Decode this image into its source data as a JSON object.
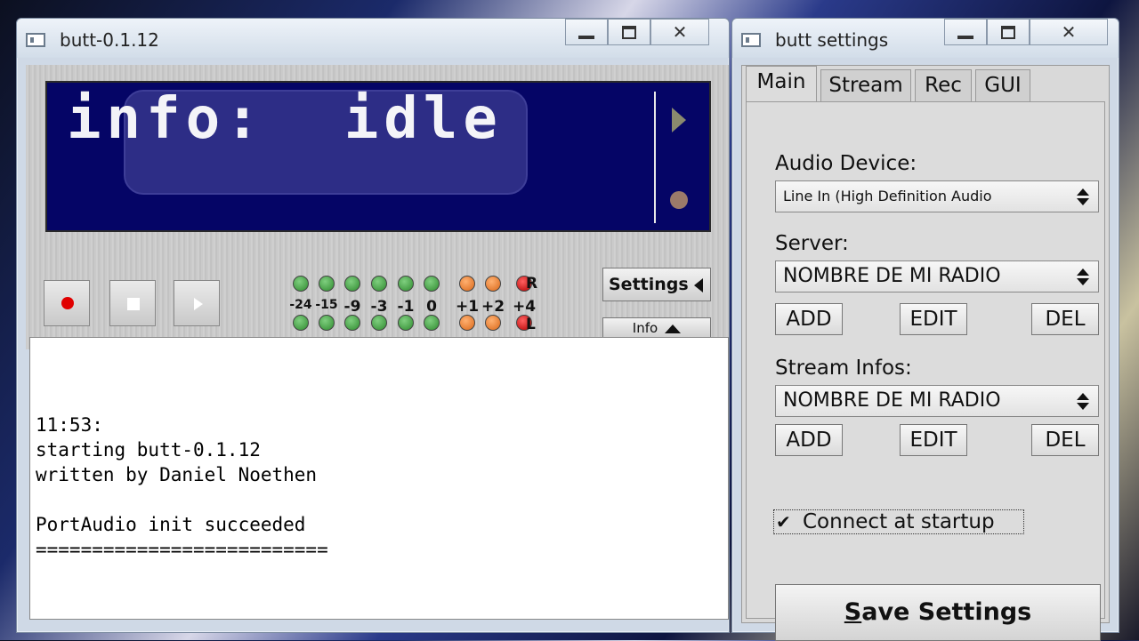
{
  "main_window": {
    "title": "butt-0.1.12",
    "lcd_text": "info:  idle",
    "meter": {
      "db_labels": [
        "-24",
        "-15",
        "-9",
        "-3",
        "-1",
        "0",
        "+1",
        "+2",
        "+4"
      ],
      "right_label": "R",
      "left_label": "L",
      "led_colors": [
        "green",
        "green",
        "green",
        "green",
        "green",
        "green",
        "orange",
        "orange",
        "red"
      ]
    },
    "settings_button": "Settings",
    "info_button": "Info",
    "log_lines": [
      "11:53:",
      "starting butt-0.1.12",
      "written by Daniel Noethen",
      "",
      "PortAudio init succeeded",
      "=========================="
    ]
  },
  "settings_window": {
    "title": "butt settings",
    "tabs": [
      "Main",
      "Stream",
      "Rec",
      "GUI"
    ],
    "active_tab": "Main",
    "audio_device_label": "Audio Device:",
    "audio_device_value": "Line In (High Definition Audio",
    "server_label": "Server:",
    "server_value": "NOMBRE DE MI RADIO",
    "stream_infos_label": "Stream Infos:",
    "stream_infos_value": "NOMBRE DE MI RADIO",
    "add_label": "ADD",
    "edit_label": "EDIT",
    "del_label": "DEL",
    "connect_at_startup_label": "Connect at startup",
    "connect_at_startup_checked": true,
    "save_first_letter": "S",
    "save_rest": "ave Settings"
  },
  "colors": {
    "lcd_background": "#050566",
    "led_green": "#3c9a3c",
    "led_orange": "#e07a28",
    "led_red": "#c00000",
    "record_red": "#e00000"
  }
}
